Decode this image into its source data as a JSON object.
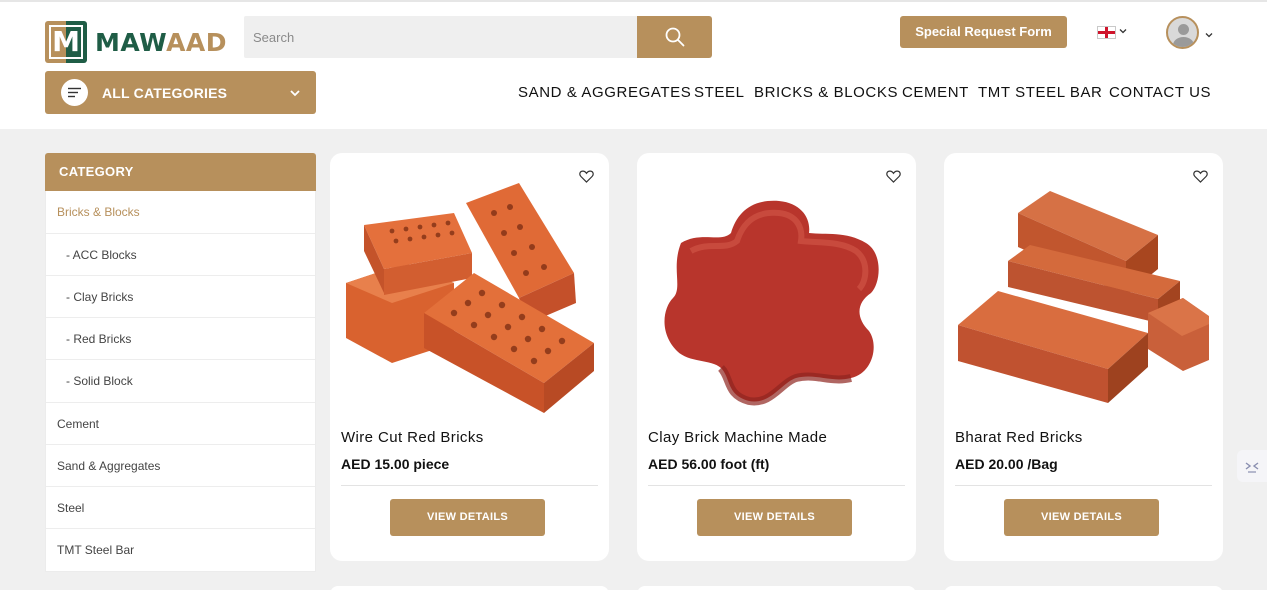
{
  "header": {
    "logo": {
      "letter": "M",
      "text_a": "MAW",
      "text_b": "AAD"
    },
    "search": {
      "placeholder": "Search"
    },
    "special_request": "Special Request Form",
    "icons": {
      "search": "search-icon",
      "flag": "uk-flag-icon",
      "user": "avatar-icon",
      "chevron": "chevron-down-icon",
      "menu": "menu-lines-icon"
    }
  },
  "all_categories": "ALL CATEGORIES",
  "nav": [
    "SAND & AGGREGATES",
    "STEEL",
    "BRICKS & BLOCKS",
    "CEMENT",
    "TMT STEEL BAR",
    "CONTACT US"
  ],
  "sidebar": {
    "heading": "CATEGORY",
    "items": [
      {
        "label": "Bricks & Blocks",
        "active": true
      },
      {
        "label": "- ACC Blocks"
      },
      {
        "label": "- Clay Bricks"
      },
      {
        "label": "- Red Bricks"
      },
      {
        "label": "- Solid Block"
      },
      {
        "label": "Cement"
      },
      {
        "label": "Sand & Aggregates"
      },
      {
        "label": "Steel"
      },
      {
        "label": "TMT Steel Bar"
      }
    ]
  },
  "products": [
    {
      "name": "Wire Cut Red Bricks",
      "price": "AED 15.00 piece",
      "button": "VIEW DETAILS"
    },
    {
      "name": "Clay Brick Machine Made",
      "price": "AED 56.00 foot (ft)",
      "button": "VIEW DETAILS"
    },
    {
      "name": "Bharat Red Bricks",
      "price": "AED 20.00 /Bag",
      "button": "VIEW DETAILS"
    }
  ],
  "colors": {
    "accent": "#b7905c",
    "brand_green": "#1f5d46",
    "brick": "#d4653a",
    "paver": "#b8332b"
  }
}
